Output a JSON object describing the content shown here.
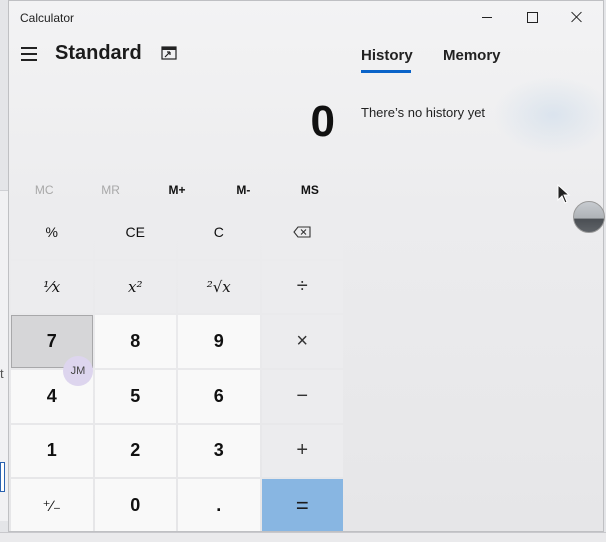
{
  "window": {
    "title": "Calculator"
  },
  "header": {
    "mode_title": "Standard"
  },
  "display": {
    "value": "0"
  },
  "memory_buttons": [
    "MC",
    "MR",
    "M+",
    "M-",
    "MS"
  ],
  "keys": {
    "percent": "%",
    "ce": "CE",
    "c": "C",
    "reciprocal": "¹⁄x",
    "square": "x²",
    "sqrt": "²√x",
    "divide": "÷",
    "seven": "7",
    "eight": "8",
    "nine": "9",
    "multiply": "×",
    "four": "4",
    "five": "5",
    "six": "6",
    "minus": "−",
    "one": "1",
    "two": "2",
    "three": "3",
    "plus": "+",
    "negate": "⁺∕₋",
    "zero": "0",
    "decimal": ".",
    "equals": "="
  },
  "side_panel": {
    "tabs": [
      "History",
      "Memory"
    ],
    "empty_message": "There’s no history yet"
  },
  "overlays": {
    "avatar_initials": "JM"
  },
  "background": {
    "fragment_text": "t"
  },
  "colors": {
    "accent": "#0a63c9",
    "equals_button": "#88b6e2"
  }
}
